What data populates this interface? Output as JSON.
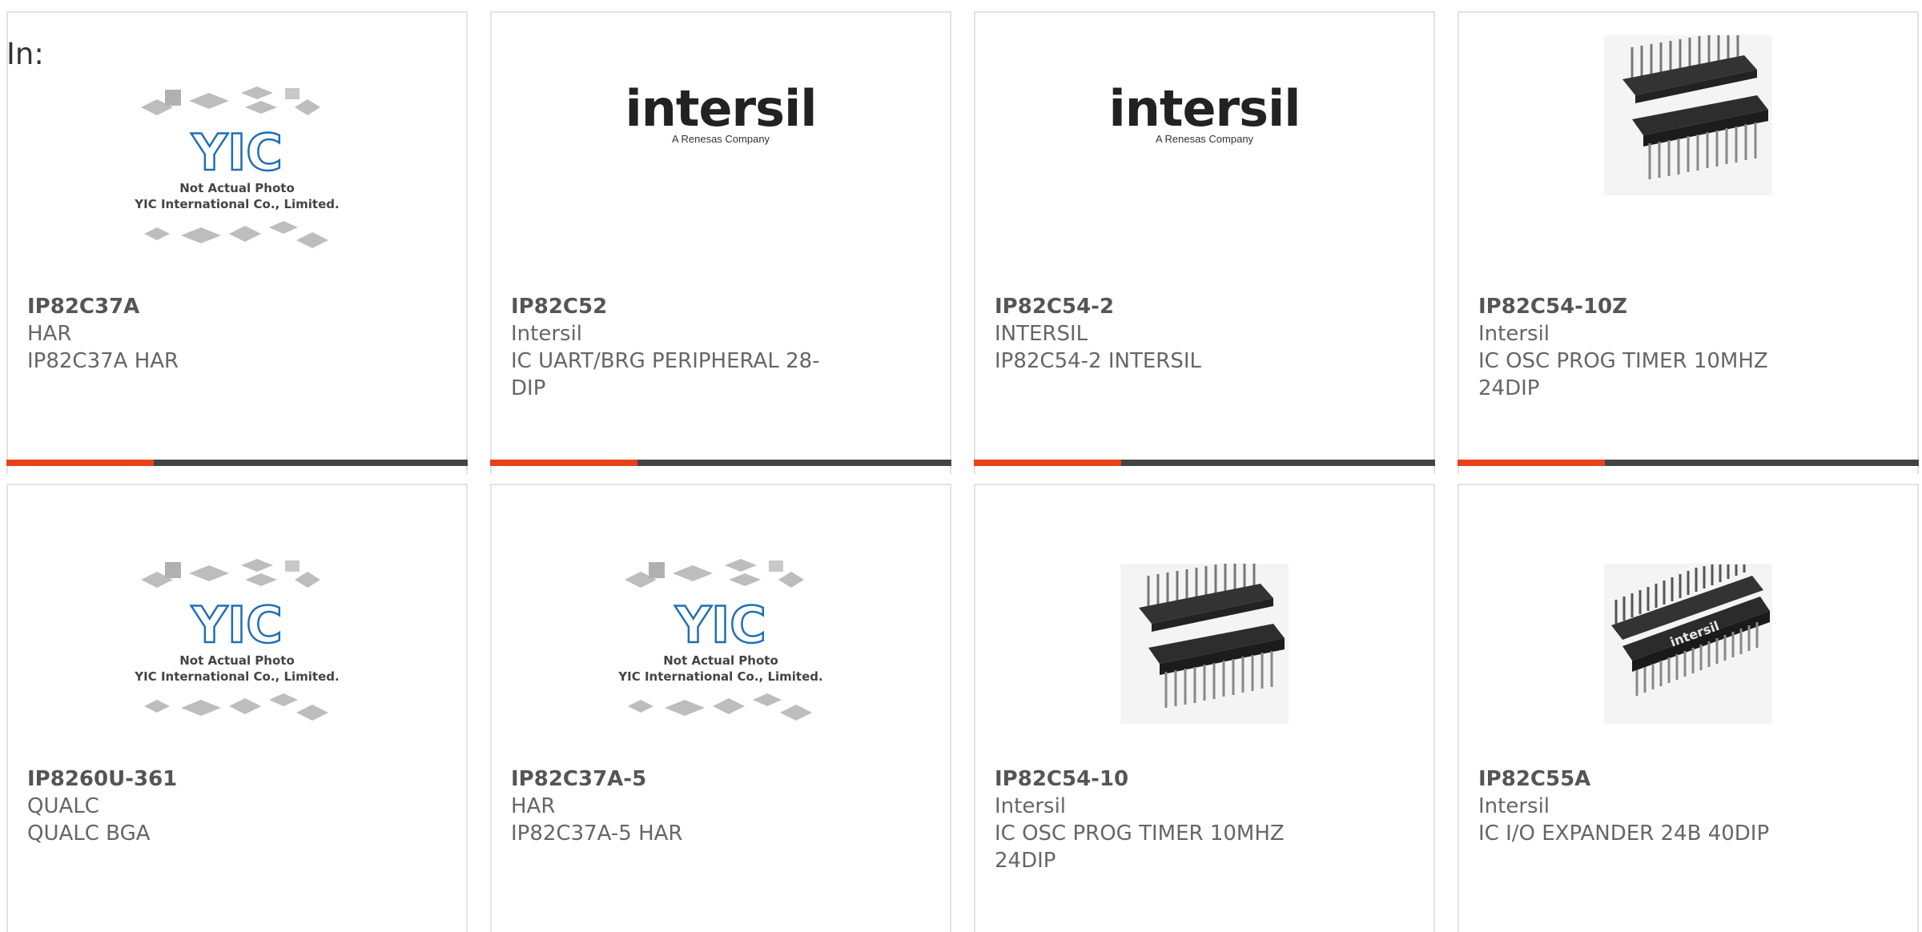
{
  "search": {
    "label": "In:"
  },
  "brand": {
    "intersil_logo": "intersil",
    "intersil_sub": "A Renesas Company",
    "yic_logo": "YIC",
    "yic_caption_1": "Not Actual Photo",
    "yic_caption_2": "YIC International Co., Limited."
  },
  "colors": {
    "accent": "#e8411a",
    "bar": "#444444",
    "border": "#e3e3e3"
  },
  "products": [
    {
      "part": "IP82C37A",
      "mfr": "HAR",
      "desc": "IP82C37A HAR",
      "image": "yic-placeholder-icon"
    },
    {
      "part": "IP82C52",
      "mfr": "Intersil",
      "desc": "IC UART/BRG PERIPHERAL 28-DIP",
      "image": "intersil-logo-icon"
    },
    {
      "part": "IP82C54-2",
      "mfr": "INTERSIL",
      "desc": "IP82C54-2 INTERSIL",
      "image": "intersil-logo-icon"
    },
    {
      "part": "IP82C54-10Z",
      "mfr": "Intersil",
      "desc": "IC OSC PROG TIMER 10MHZ 24DIP",
      "image": "dip-chip-icon"
    },
    {
      "part": "IP8260U-361",
      "mfr": "QUALC",
      "desc": "QUALC BGA",
      "image": "yic-placeholder-icon"
    },
    {
      "part": "IP82C37A-5",
      "mfr": "HAR",
      "desc": "IP82C37A-5 HAR",
      "image": "yic-placeholder-icon"
    },
    {
      "part": "IP82C54-10",
      "mfr": "Intersil",
      "desc": "IC OSC PROG TIMER 10MHZ 24DIP",
      "image": "dip-chip-icon"
    },
    {
      "part": "IP82C55A",
      "mfr": "Intersil",
      "desc": "IC I/O EXPANDER 24B 40DIP",
      "image": "dip-chip-intersil-icon"
    }
  ]
}
